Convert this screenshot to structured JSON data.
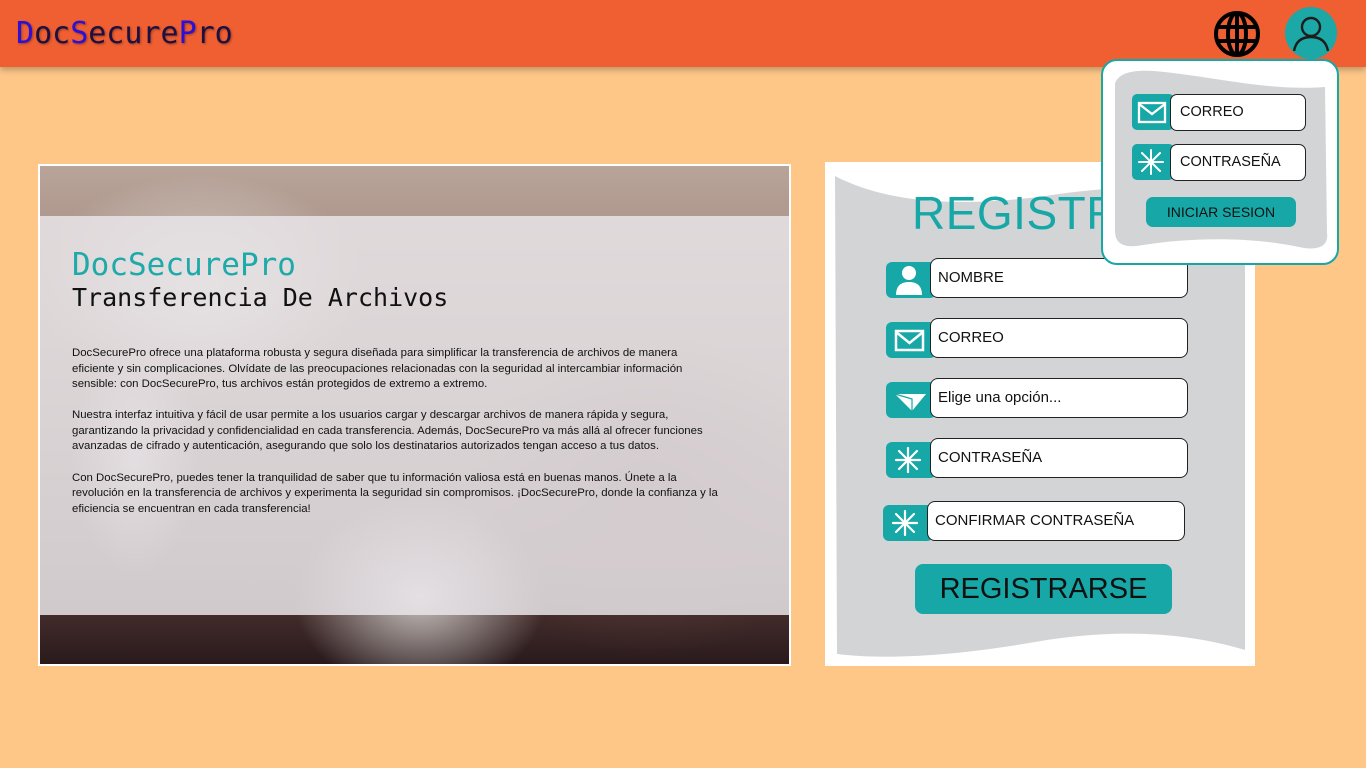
{
  "header": {
    "logo_parts": [
      "D",
      "oc",
      "S",
      "ecure",
      "P",
      "ro"
    ],
    "globe_icon": "globe-icon",
    "user_icon": "user-avatar-icon"
  },
  "hero": {
    "title": "DocSecurePro",
    "subtitle": "Transferencia De Archivos",
    "paragraphs": [
      "DocSecurePro ofrece una plataforma robusta y segura diseñada para simplificar la transferencia de archivos de manera eficiente y sin complicaciones. Olvídate de las preocupaciones relacionadas con la seguridad al intercambiar información sensible: con DocSecurePro, tus archivos están protegidos de extremo a extremo.",
      "Nuestra interfaz intuitiva y fácil de usar permite a los usuarios cargar y descargar archivos de manera rápida y segura, garantizando la privacidad y confidencialidad en cada transferencia. Además, DocSecurePro va más allá al ofrecer funciones avanzadas de cifrado y autenticación, asegurando que solo los destinatarios autorizados tengan acceso a tus datos.",
      "Con DocSecurePro, puedes tener la tranquilidad de saber que tu información valiosa está en buenas manos. Únete a la revolución en la transferencia de archivos y experimenta la seguridad sin compromisos. ¡DocSecurePro, donde la confianza y la eficiencia se encuentran en cada transferencia!"
    ]
  },
  "register": {
    "title": "REGISTRARSE",
    "name_placeholder": "NOMBRE",
    "email_placeholder": "CORREO",
    "select_value": "Elige una opción...",
    "password_placeholder": "CONTRASEÑA",
    "confirm_placeholder": "CONFIRMAR CONTRASEÑA",
    "submit_label": "REGISTRARSE"
  },
  "login": {
    "email_placeholder": "CORREO",
    "password_placeholder": "CONTRASEÑA",
    "submit_label": "INICIAR SESION"
  },
  "colors": {
    "header": "#ef5f32",
    "background": "#fec788",
    "accent": "#17a7a7",
    "logo_blue": "#2a10d8"
  }
}
